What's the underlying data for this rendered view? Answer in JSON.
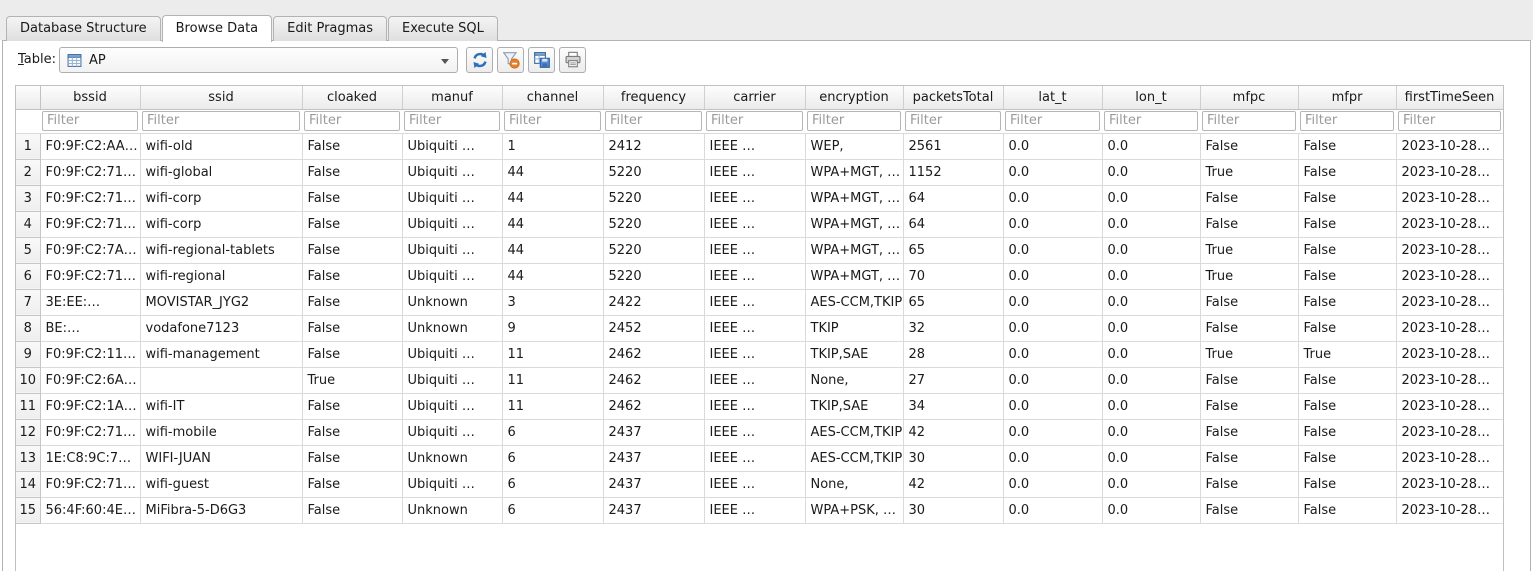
{
  "tabs": [
    {
      "label": "Database Structure",
      "active": false
    },
    {
      "label": "Browse Data",
      "active": true
    },
    {
      "label": "Edit Pragmas",
      "active": false
    },
    {
      "label": "Execute SQL",
      "active": false
    }
  ],
  "toolbar": {
    "table_label": "Table:",
    "table_name": "AP",
    "icons": {
      "combo_table": "table-grid-icon",
      "combo_arrow": "chevron-down-icon",
      "buttons": [
        "refresh-icon",
        "clear-filter-icon",
        "save-results-icon",
        "print-icon"
      ]
    }
  },
  "grid": {
    "filter_placeholder": "Filter",
    "columns": [
      "bssid",
      "ssid",
      "cloaked",
      "manuf",
      "channel",
      "frequency",
      "carrier",
      "encryption",
      "packetsTotal",
      "lat_t",
      "lon_t",
      "mfpc",
      "mfpr",
      "firstTimeSeen"
    ],
    "rows": [
      {
        "num": "1",
        "cells": [
          "F0:9F:C2:AA…",
          "wifi-old",
          "False",
          "Ubiquiti …",
          "1",
          "2412",
          "IEEE …",
          "WEP,",
          "2561",
          "0.0",
          "0.0",
          "False",
          "False",
          "2023-10-28…"
        ]
      },
      {
        "num": "2",
        "cells": [
          "F0:9F:C2:71…",
          "wifi-global",
          "False",
          "Ubiquiti …",
          "44",
          "5220",
          "IEEE …",
          "WPA+MGT, …",
          "1152",
          "0.0",
          "0.0",
          "True",
          "False",
          "2023-10-28…"
        ]
      },
      {
        "num": "3",
        "cells": [
          "F0:9F:C2:71…",
          "wifi-corp",
          "False",
          "Ubiquiti …",
          "44",
          "5220",
          "IEEE …",
          "WPA+MGT, …",
          "64",
          "0.0",
          "0.0",
          "False",
          "False",
          "2023-10-28…"
        ]
      },
      {
        "num": "4",
        "cells": [
          "F0:9F:C2:71…",
          "wifi-corp",
          "False",
          "Ubiquiti …",
          "44",
          "5220",
          "IEEE …",
          "WPA+MGT, …",
          "64",
          "0.0",
          "0.0",
          "False",
          "False",
          "2023-10-28…"
        ]
      },
      {
        "num": "5",
        "cells": [
          "F0:9F:C2:7A…",
          "wifi-regional-tablets",
          "False",
          "Ubiquiti …",
          "44",
          "5220",
          "IEEE …",
          "WPA+MGT, …",
          "65",
          "0.0",
          "0.0",
          "True",
          "False",
          "2023-10-28…"
        ]
      },
      {
        "num": "6",
        "cells": [
          "F0:9F:C2:71…",
          "wifi-regional",
          "False",
          "Ubiquiti …",
          "44",
          "5220",
          "IEEE …",
          "WPA+MGT, …",
          "70",
          "0.0",
          "0.0",
          "True",
          "False",
          "2023-10-28…"
        ]
      },
      {
        "num": "7",
        "cells": [
          "3E:EE:…",
          "MOVISTAR_JYG2",
          "False",
          "Unknown",
          "3",
          "2422",
          "IEEE …",
          "AES-CCM,TKIP",
          "65",
          "0.0",
          "0.0",
          "False",
          "False",
          "2023-10-28…"
        ]
      },
      {
        "num": "8",
        "cells": [
          "BE:…",
          "vodafone7123",
          "False",
          "Unknown",
          "9",
          "2452",
          "IEEE …",
          "TKIP",
          "32",
          "0.0",
          "0.0",
          "False",
          "False",
          "2023-10-28…"
        ]
      },
      {
        "num": "9",
        "cells": [
          "F0:9F:C2:11…",
          "wifi-management",
          "False",
          "Ubiquiti …",
          "11",
          "2462",
          "IEEE …",
          "TKIP,SAE",
          "28",
          "0.0",
          "0.0",
          "True",
          "True",
          "2023-10-28…"
        ]
      },
      {
        "num": "10",
        "cells": [
          "F0:9F:C2:6A…",
          "",
          "True",
          "Ubiquiti …",
          "11",
          "2462",
          "IEEE …",
          "None,",
          "27",
          "0.0",
          "0.0",
          "False",
          "False",
          "2023-10-28…"
        ]
      },
      {
        "num": "11",
        "cells": [
          "F0:9F:C2:1A…",
          "wifi-IT",
          "False",
          "Ubiquiti …",
          "11",
          "2462",
          "IEEE …",
          "TKIP,SAE",
          "34",
          "0.0",
          "0.0",
          "False",
          "False",
          "2023-10-28…"
        ]
      },
      {
        "num": "12",
        "cells": [
          "F0:9F:C2:71…",
          "wifi-mobile",
          "False",
          "Ubiquiti …",
          "6",
          "2437",
          "IEEE …",
          "AES-CCM,TKIP",
          "42",
          "0.0",
          "0.0",
          "False",
          "False",
          "2023-10-28…"
        ]
      },
      {
        "num": "13",
        "cells": [
          "1E:C8:9C:7…",
          "WIFI-JUAN",
          "False",
          "Unknown",
          "6",
          "2437",
          "IEEE …",
          "AES-CCM,TKIP",
          "30",
          "0.0",
          "0.0",
          "False",
          "False",
          "2023-10-28…"
        ]
      },
      {
        "num": "14",
        "cells": [
          "F0:9F:C2:71…",
          "wifi-guest",
          "False",
          "Ubiquiti …",
          "6",
          "2437",
          "IEEE …",
          "None,",
          "42",
          "0.0",
          "0.0",
          "False",
          "False",
          "2023-10-28…"
        ]
      },
      {
        "num": "15",
        "cells": [
          "56:4F:60:4E…",
          "MiFibra-5-D6G3",
          "False",
          "Unknown",
          "6",
          "2437",
          "IEEE …",
          "WPA+PSK, …",
          "30",
          "0.0",
          "0.0",
          "False",
          "False",
          "2023-10-28…"
        ]
      }
    ]
  },
  "colors": {
    "accent_blue": "#2f6fb8",
    "badge_orange": "#e8822a",
    "chrome_gray": "#ececec",
    "grid_line": "#dadada",
    "header_border": "#c2c2c2"
  }
}
